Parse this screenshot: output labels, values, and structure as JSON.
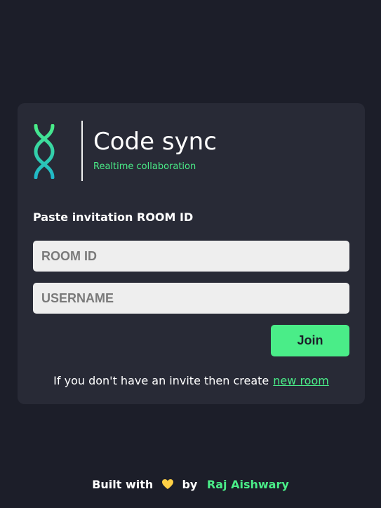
{
  "brand": {
    "title": "Code sync",
    "subtitle": "Realtime collaboration",
    "logo_icon": "dna-icon"
  },
  "form": {
    "label": "Paste invitation ROOM ID",
    "room_id_placeholder": "ROOM ID",
    "room_id_value": "",
    "username_placeholder": "USERNAME",
    "username_value": "",
    "join_label": "Join",
    "create_text": "If you don't have an invite then create",
    "create_link": "new room"
  },
  "footer": {
    "built_with": "Built with",
    "heart_icon": "heart-icon",
    "by": "by",
    "author": "Raj Aishwary"
  },
  "colors": {
    "background": "#1c1e29",
    "card": "#282a36",
    "accent": "#4aed88",
    "heart": "#ffd045"
  }
}
